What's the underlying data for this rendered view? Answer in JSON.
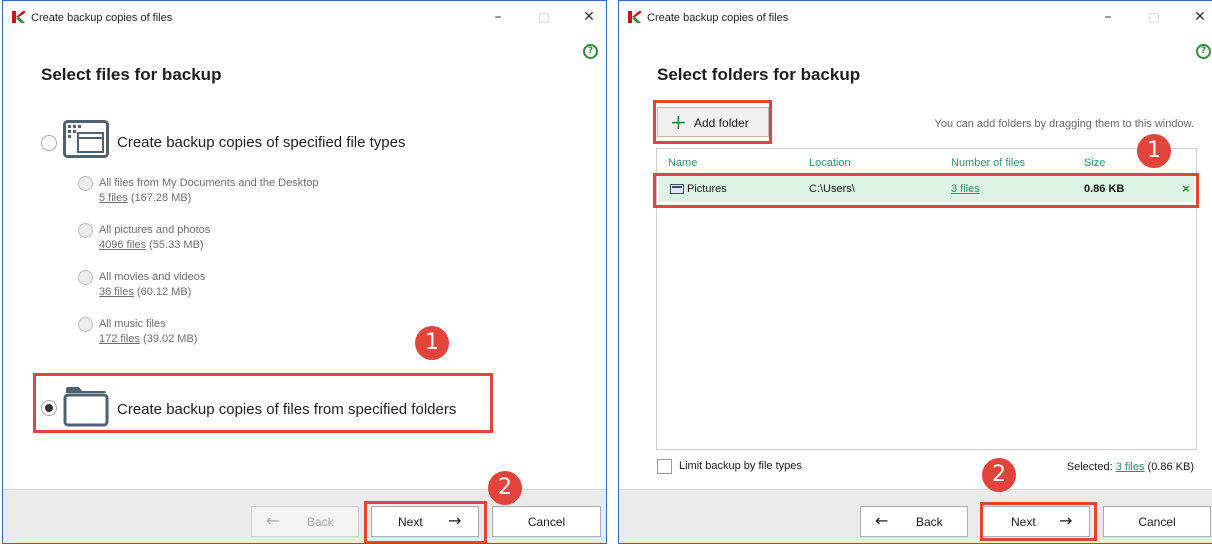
{
  "colors": {
    "accent_green": "#2e8b3a",
    "highlight_red": "#e0443b",
    "window_border": "#2b6cc4",
    "row_selected": "#dcf3e6"
  },
  "left_window": {
    "title": "Create backup copies of files",
    "controls": {
      "minimize": "–",
      "maximize": "□",
      "close": "✕"
    },
    "help": "?",
    "heading": "Select files for backup",
    "option_types": {
      "label": "Create backup copies of specified file types",
      "selected": false,
      "icon": "file-types-window-icon"
    },
    "sub_options": [
      {
        "label": "All files from My Documents and the Desktop",
        "count": "5 files",
        "size": "(167.28 MB)"
      },
      {
        "label": "All pictures and photos",
        "count": "4096 files",
        "size": "(55.33 MB)"
      },
      {
        "label": "All movies and videos",
        "count": "36 files",
        "size": "(60.12 MB)"
      },
      {
        "label": "All music files",
        "count": "172 files",
        "size": "(39.02 MB)"
      }
    ],
    "option_folders": {
      "label": "Create backup copies of files from specified folders",
      "selected": true,
      "icon": "folder-icon"
    },
    "footer": {
      "back": "Back",
      "next": "Next",
      "cancel": "Cancel"
    },
    "badges": {
      "one": "1",
      "two": "2"
    }
  },
  "right_window": {
    "title": "Create backup copies of files",
    "controls": {
      "minimize": "–",
      "maximize": "□",
      "close": "✕"
    },
    "help": "?",
    "heading": "Select folders for backup",
    "add_folder": "Add folder",
    "drag_hint": "You can add folders by dragging them to this window.",
    "columns": {
      "name": "Name",
      "location": "Location",
      "number": "Number of files",
      "size": "Size"
    },
    "rows": [
      {
        "name": "Pictures",
        "location": "C:\\Users\\",
        "files": "3 files",
        "size": "0.86 KB",
        "remove": "×"
      }
    ],
    "limit_label": "Limit backup by file types",
    "selected_prefix": "Selected:",
    "selected_link": "3 files",
    "selected_size": "(0.86 KB)",
    "footer": {
      "back": "Back",
      "next": "Next",
      "cancel": "Cancel"
    },
    "badges": {
      "one": "1",
      "two": "2"
    }
  }
}
